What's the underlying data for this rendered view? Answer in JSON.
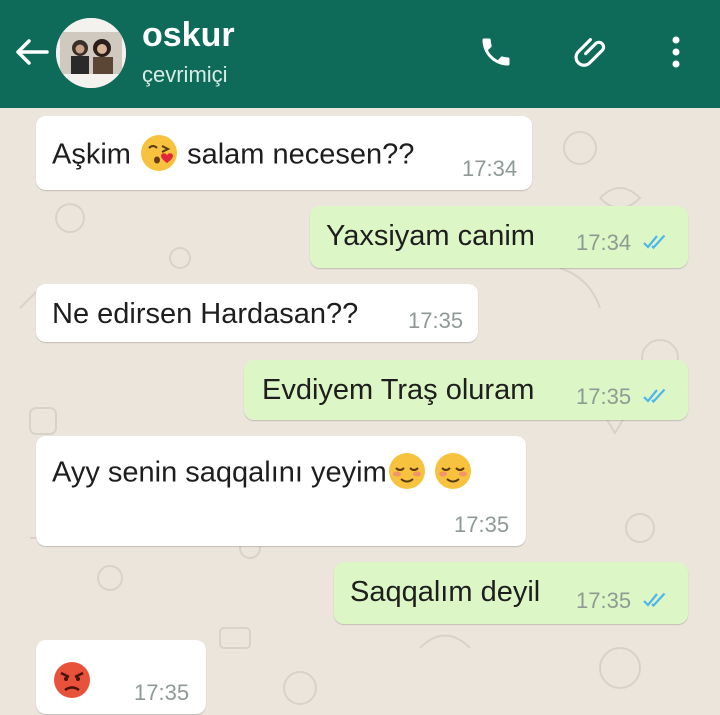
{
  "header": {
    "contact_name": "oskur",
    "status": "çevrimiçi",
    "icons": [
      "back-arrow-icon",
      "phone-icon",
      "paperclip-icon",
      "more-vert-icon"
    ]
  },
  "colors": {
    "header_bg": "#0e6b5a",
    "incoming_bubble": "#ffffff",
    "outgoing_bubble": "#dcf7c5",
    "read_ticks": "#4fb6ec"
  },
  "messages": [
    {
      "direction": "incoming",
      "text_before": "Aşkim",
      "emoji": "kissing-heart-emoji",
      "text_after": "salam necesen??",
      "time": "17:34"
    },
    {
      "direction": "outgoing",
      "text": "Yaxsiyam canim",
      "time": "17:34",
      "status": "read"
    },
    {
      "direction": "incoming",
      "text": "Ne edirsen Hardasan??",
      "time": "17:35"
    },
    {
      "direction": "outgoing",
      "text": "Evdiyem Traş oluram",
      "time": "17:35",
      "status": "read"
    },
    {
      "direction": "incoming",
      "text": "Ayy senin saqqalını yeyim",
      "emoji": [
        "relieved-smile-emoji",
        "relieved-smile-emoji"
      ],
      "time": "17:35"
    },
    {
      "direction": "outgoing",
      "text": "Saqqalım deyil",
      "time": "17:35",
      "status": "read"
    },
    {
      "direction": "incoming",
      "emoji": "angry-face-emoji",
      "time": "17:35"
    }
  ]
}
